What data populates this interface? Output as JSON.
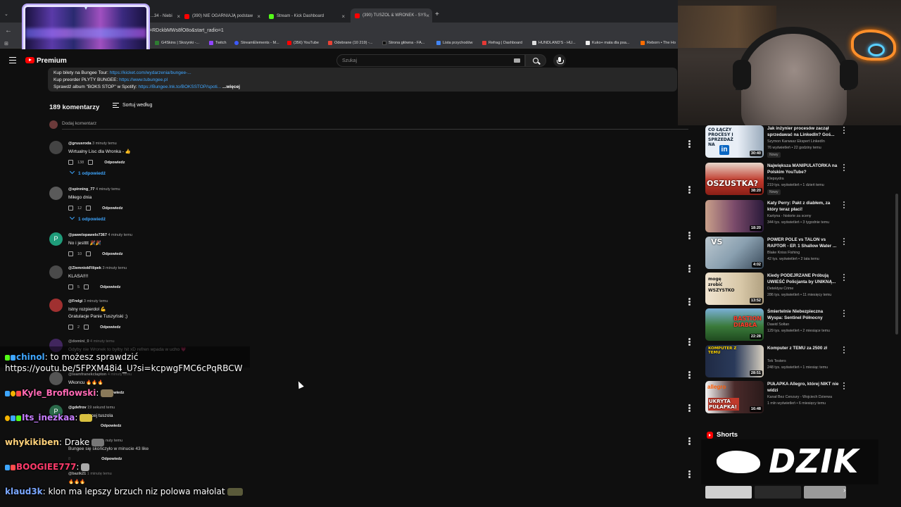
{
  "browser": {
    "tabs": [
      {
        "title": "...34 - Niebi",
        "color": "#ff0000"
      },
      {
        "title": "(390) NIE OGARNIAJĄ podstaw",
        "color": "#ff0000"
      },
      {
        "title": "Stream - Kick Dashboard",
        "color": "#53fc18"
      },
      {
        "title": "(390) TUSZOL & WRONEK - SYS",
        "color": "#ff0000"
      }
    ],
    "new_tab": "+",
    "url": "=RDckbMWs8fO8o&start_radio=1",
    "bookmarks": [
      {
        "label": "G4Skins | Skrzynki -...",
        "color": "#2e7d32"
      },
      {
        "label": "Twitch",
        "color": "#9146ff"
      },
      {
        "label": "StreamElements - M...",
        "color": "#3d5afe"
      },
      {
        "label": "(356) YouTube",
        "color": "#ff0000"
      },
      {
        "label": "Odebrane (10 219) -...",
        "color": "#ea4335"
      },
      {
        "label": "Strona główna - FA...",
        "color": "#111111"
      },
      {
        "label": "Lista przychodów",
        "color": "#4285f4"
      },
      {
        "label": "Refrag | Dashboard",
        "color": "#e53935"
      },
      {
        "label": "HUNDLAND'S - HU...",
        "color": "#dddddd"
      },
      {
        "label": "Kuko+ mata dla psa...",
        "color": "#eeeeee"
      },
      {
        "label": "Reborn • The Ho",
        "color": "#ff6d00"
      }
    ]
  },
  "header": {
    "logo": "Premium",
    "search_placeholder": "Szukaj"
  },
  "description": {
    "line1_text": "Kup bilety na Bungee Tour: ",
    "line1_link": "https://kicket.com/wydarzenia/bungee-...",
    "line2_text": "Kup preorder PŁYTY BUNGEE: ",
    "line2_link": "https://www.tubungee.pl",
    "line3_text": "Sprawdź album \"BOKS STOP\" w Spotify: ",
    "line3_link": "https://Bungee.lnk.to/BOKSSTOP/spoti...",
    "more": "...więcej"
  },
  "comments_section": {
    "count": "189 komentarzy",
    "sort_label": "Sortuj według",
    "add_comment": "Dodaj komentarz",
    "reply_label": "Odpowiedz",
    "comments": [
      {
        "author": "@gruusroda",
        "time": "3 minuty temu",
        "text": "Wirtualny Lisc dla Wronka - 👍",
        "likes": "138",
        "replies": "1 odpowiedź",
        "avatar_color": "#444444",
        "avatar_letter": ""
      },
      {
        "author": "@spinning_77",
        "time": "4 minuty temu",
        "text": "Miłego dnia",
        "likes": "12",
        "replies": "1 odpowiedź",
        "avatar_color": "#5a5a5a",
        "avatar_letter": ""
      },
      {
        "author": "@pawelopawelo7367",
        "time": "4 minuty temu",
        "text": "No i jestttt 🎉🎉",
        "likes": "10",
        "replies": "",
        "avatar_color": "#1f9c7a",
        "avatar_letter": "P"
      },
      {
        "author": "@ZiemniokFilipek",
        "time": "3 minuty temu",
        "text": "KLASA!!!!",
        "likes": "5",
        "replies": "",
        "avatar_color": "#4a4a4a",
        "avatar_letter": ""
      },
      {
        "author": "@Frelgi",
        "time": "3 minuty temu",
        "text": "Istny rozpierdol 💪",
        "text2": "Gratulacje Panie Tuszyński ;)",
        "likes": "2",
        "replies": "",
        "avatar_color": "#a03030",
        "avatar_letter": ""
      },
      {
        "author": "@domini_0",
        "time": "4 minuty temu",
        "text": "Gdyby nie Wronek to byłby hit xD refren wpada w ucho 💗",
        "likes": "",
        "replies": "",
        "avatar_color": "#6a3aa0",
        "avatar_letter": ""
      },
      {
        "author": "@teamfranekclapton",
        "time": "4 minuty temu",
        "text": "Wkoncu 🔥🔥🔥",
        "likes": "",
        "replies": "",
        "avatar_color": "#555555",
        "avatar_letter": ""
      },
      {
        "author": "@gdefrov",
        "time": "19 sekund temu",
        "text": "więcej tuszola",
        "likes": "",
        "replies": "",
        "avatar_color": "#2a6a4a",
        "avatar_letter": "P"
      },
      {
        "author": "",
        "time": "nuty temu",
        "text": "Bungee się skończyło w minucie 43 like",
        "likes": "8",
        "replies": "",
        "avatar_color": "#3a2a2a",
        "avatar_letter": ""
      },
      {
        "author": "@bazik21",
        "time": "1 minutę temu",
        "text": "🔥🔥🔥",
        "likes": "",
        "replies": "",
        "avatar_color": "#333333",
        "avatar_letter": ""
      }
    ]
  },
  "chat": {
    "messages": [
      {
        "user": "chinol",
        "user_color": "#3ea6ff",
        "text": ": to możesz sprawdzić",
        "text2": "https://youtu.be/5FPXM48i4_U?si=kcpwgFMC6cPqRBCW"
      },
      {
        "user": "Kyle_Broflowski",
        "user_color": "#ff69b4",
        "text": ":"
      },
      {
        "user": "Its_inezkaa",
        "user_color": "#c77dff",
        "text": ":"
      },
      {
        "user": "whykikiben",
        "user_color": "#ffd27a",
        "text": ": Drake"
      },
      {
        "user": "BOOGIEE777",
        "user_color": "#ff3b6b",
        "text": ":"
      },
      {
        "user": "klaud3k",
        "user_color": "#7aa7ff",
        "text": ": klon ma lepszy brzuch niz polowa małolat"
      }
    ]
  },
  "sidebar": {
    "videos": [
      {
        "title": "Jak inżynier procesów zaczął sprzedawać na LinkedIn? Goś...",
        "channel": "Szymon Karwasz Ekspert LinkedIn",
        "meta": "76 wyświetleń • 22 godziny temu",
        "badge": "Nowy",
        "duration": "30:40",
        "thumb_text": "CO ŁĄCZY PROCESY I SPRZEDAŻ NA",
        "thumb_bg": "#e8eef6"
      },
      {
        "title": "Największa MANIPULATORKA na Polskim YouTube?",
        "channel": "Klepsydra",
        "meta": "219 tys. wyświetleń • 1 dzień temu",
        "badge": "Nowy",
        "duration": "38:20",
        "thumb_text": "OSZUSTKA?",
        "thumb_bg": "#c0392b"
      },
      {
        "title": "Katy Perry: Pakt z diabłem, za który teraz płaci!",
        "channel": "Kartyna - historie za sceny",
        "meta": "344 tys. wyświetleń • 3 tygodnie temu",
        "badge": "",
        "duration": "18:20",
        "thumb_text": "",
        "thumb_bg": "#7a4a6a"
      },
      {
        "title": "POWER POLE vs TALON vs RAPTOR - EP. 1 Shallow Water ...",
        "channel": "Blake Kniss Fishing",
        "meta": "42 tys. wyświetleń • 2 lata temu",
        "badge": "",
        "duration": "4:02",
        "thumb_text": "VS",
        "thumb_bg": "#8aa0b0"
      },
      {
        "title": "Kiedy PODEJRZANE Próbują UWIEŚĆ Policjanta by UNIKNĄ...",
        "channel": "Detektyw Crime",
        "meta": "286 tys. wyświetleń • 11 miesięcy temu",
        "badge": "",
        "duration": "13:52",
        "thumb_text": "mogę zrobić WSZYSTKO",
        "thumb_bg": "#d8c8a8"
      },
      {
        "title": "Śmiertelnie Niebezpieczna Wyspa: Sentinel Północny",
        "channel": "Dawid Sołtan",
        "meta": "129 tys. wyświetleń • 2 miesiące temu",
        "badge": "",
        "duration": "22:28",
        "thumb_text": "BASTION DIABŁA",
        "thumb_bg": "#3a7a3a"
      },
      {
        "title": "Komputer z TEMU za 2500 zł",
        "channel": "Tek Testers",
        "meta": "248 tys. wyświetleń • 1 miesiąc temu",
        "badge": "",
        "duration": "28:51",
        "thumb_text": "KOMPUTER Z TEMU",
        "thumb_bg": "#2a3a5a"
      },
      {
        "title": "PUŁAPKA Allegro, której NIKT nie widzi",
        "channel": "Kanał Bez Cenzury - Wojciech Dzierwa",
        "meta": "1 mln wyświetleń • 6 miesięcy temu",
        "badge": "",
        "duration": "16:48",
        "thumb_text": "UKRYTA PUŁAPKA!",
        "thumb_bg": "#4a2a2a"
      }
    ],
    "shorts_label": "Shorts",
    "shorts_text": "DZIK"
  }
}
